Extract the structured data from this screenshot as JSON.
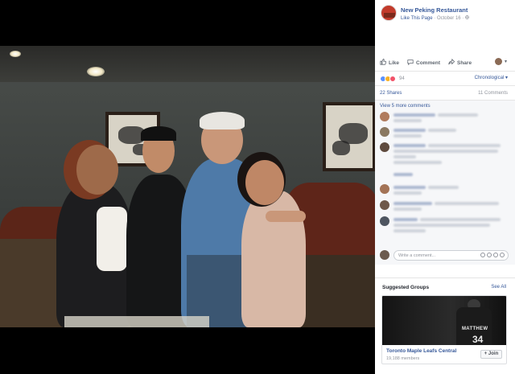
{
  "post": {
    "page_name": "New Peking Restaurant",
    "like_page": "Like This Page",
    "separator": "·",
    "date": "October 16",
    "privacy_icon": "globe-icon"
  },
  "actions": {
    "like": "Like",
    "comment": "Comment",
    "share": "Share"
  },
  "reactions": {
    "icons": [
      "like-reaction",
      "wow-reaction",
      "love-reaction"
    ],
    "colors": [
      "#5890ff",
      "#f7b125",
      "#f25268"
    ],
    "count": "94",
    "order": "Chronological"
  },
  "stats": {
    "shares": "22 Shares",
    "comments": "11 Comments"
  },
  "comments_section": {
    "view_more": "View 5 more comments",
    "write_placeholder": "Write a comment..."
  },
  "suggested": {
    "title": "Suggested Groups",
    "see_all": "See All",
    "group": {
      "name": "Toronto Maple Leafs Central",
      "members": "19,188 members",
      "join": "Join",
      "jersey_text": "MATTHEW",
      "jersey_number": "34"
    }
  }
}
